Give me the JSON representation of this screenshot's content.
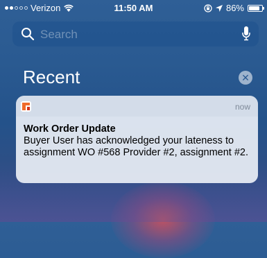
{
  "status_bar": {
    "carrier": "Verizon",
    "time": "11:50 AM",
    "battery": "86%",
    "battery_level": 0.86
  },
  "search": {
    "placeholder": "Search"
  },
  "recent": {
    "title": "Recent"
  },
  "notification": {
    "time": "now",
    "title": "Work Order Update",
    "body": "Buyer User has acknowledged your lateness to assignment WO #568 Provider #2, assignment #2."
  },
  "icons": [
    "wifi-icon",
    "lock-rotation-icon",
    "location-arrow-icon",
    "battery-icon",
    "search-icon",
    "microphone-icon",
    "close-icon",
    "app-icon"
  ]
}
